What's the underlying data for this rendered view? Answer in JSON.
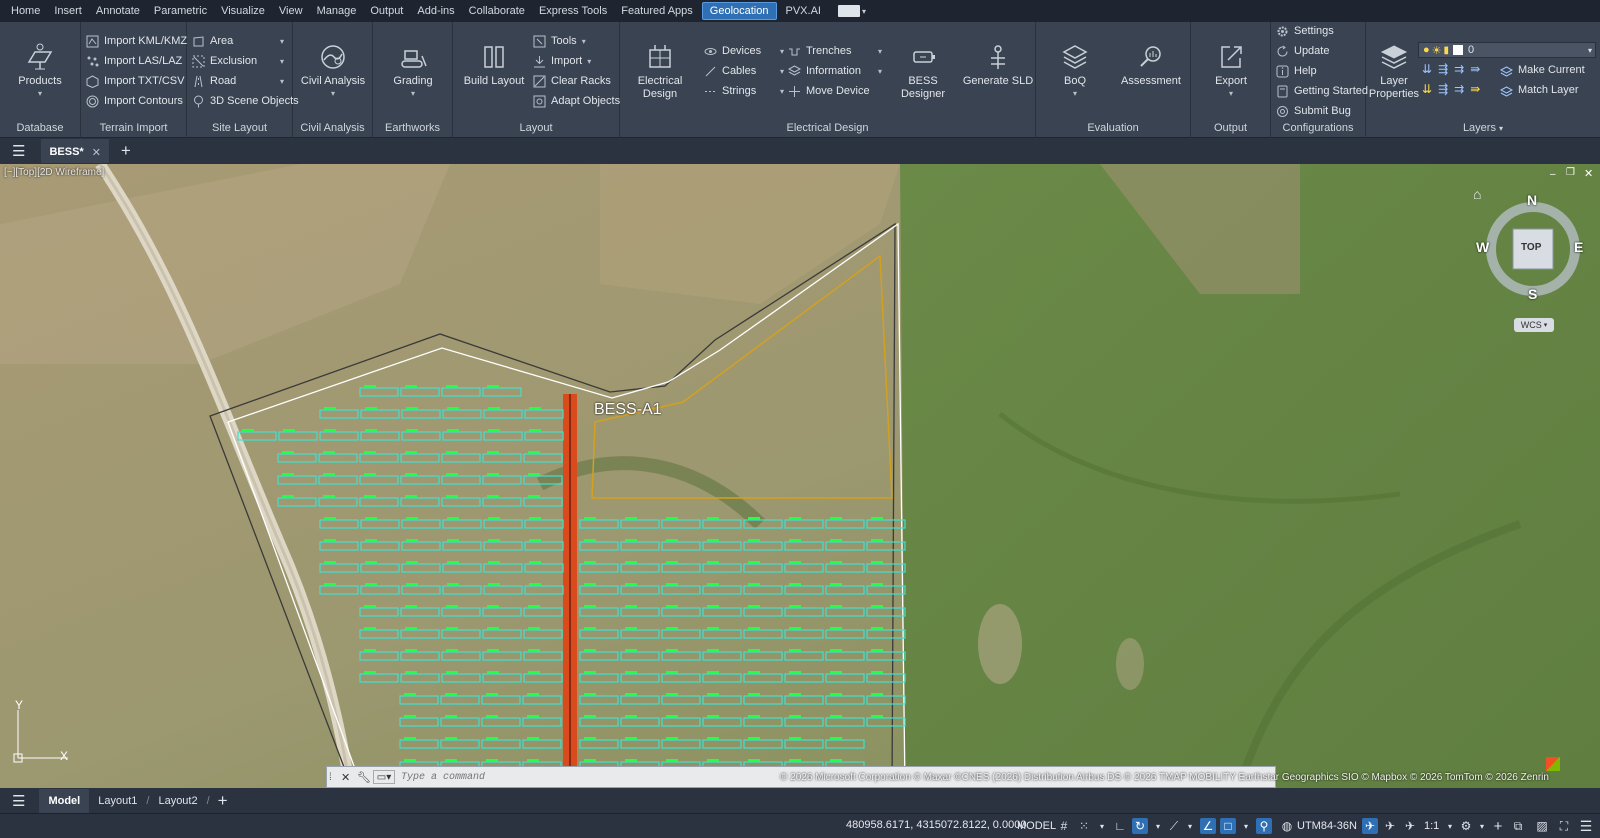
{
  "menu": {
    "tabs": [
      "Home",
      "Insert",
      "Annotate",
      "Parametric",
      "Visualize",
      "View",
      "Manage",
      "Output",
      "Add-ins",
      "Collaborate",
      "Express Tools",
      "Featured Apps",
      "Geolocation",
      "PVX.AI"
    ],
    "active": "Geolocation"
  },
  "ribbon": {
    "database": {
      "title": "Database",
      "products": "Products"
    },
    "terrain": {
      "title": "Terrain Import",
      "items": [
        "Import KML/KMZ",
        "Import LAS/LAZ",
        "Import TXT/CSV",
        "Import Contours"
      ]
    },
    "site": {
      "title": "Site Layout",
      "items": [
        "Area",
        "Exclusion",
        "Road",
        "3D Scene Objects"
      ]
    },
    "civil": {
      "title": "Civil Analysis",
      "button": "Civil Analysis"
    },
    "earth": {
      "title": "Earthworks",
      "button": "Grading"
    },
    "layout": {
      "title": "Layout",
      "build": "Build Layout",
      "items": [
        "Tools",
        "Import",
        "Clear Racks",
        "Adapt Objects"
      ]
    },
    "elec": {
      "title": "Electrical Design",
      "button": "Electrical Design",
      "col1": [
        "Devices",
        "Cables",
        "Strings"
      ],
      "col2": [
        "Trenches",
        "Information",
        "Move Device"
      ],
      "bess": "BESS Designer",
      "sld": "Generate SLD"
    },
    "eval": {
      "title": "Evaluation",
      "boq": "BoQ",
      "assess": "Assessment"
    },
    "output": {
      "title": "Output",
      "export": "Export"
    },
    "config": {
      "title": "Configurations",
      "items": [
        "Settings",
        "Update",
        "Help",
        "Getting Started",
        "Submit Bug"
      ]
    },
    "layers": {
      "title": "Layers",
      "props_line1": "Layer",
      "props_line2": "Properties",
      "current_layer": "0",
      "make_current": "Make Current",
      "match_layer": "Match Layer"
    }
  },
  "doc": {
    "tab": "BESS*"
  },
  "viewport": {
    "label": "[−][Top][2D Wireframe]",
    "bess_label": "BESS-A1",
    "compass": {
      "n": "N",
      "s": "S",
      "e": "E",
      "w": "W",
      "top": "TOP"
    },
    "wcs": "WCS",
    "ucs_y": "Y",
    "ucs_x": "X"
  },
  "command": {
    "placeholder": "Type a command"
  },
  "attribution": "© 2026 Microsoft Corporation © Maxar ©CNES (2026) Distribution Airbus DS © 2026 TMAP MOBILITY Earthstar Geographics SIO © Mapbox © 2026 TomTom © 2026 Zenrin",
  "layouts": {
    "tabs": [
      "Model",
      "Layout1",
      "Layout2"
    ],
    "active": "Model"
  },
  "status": {
    "coords": "480958.6171, 4315072.8122, 0.0000",
    "model": "MODEL",
    "crs": "UTM84-36N",
    "scale": "1:1"
  },
  "colors": {
    "accent": "#2f6fb3",
    "ribbon": "#3a4352",
    "panel_rows": "#40e0d0",
    "row_green": "#22ff44",
    "trench": "#d94a1c",
    "boundary": "#ffffff",
    "bess_outline": "#d4a020"
  }
}
